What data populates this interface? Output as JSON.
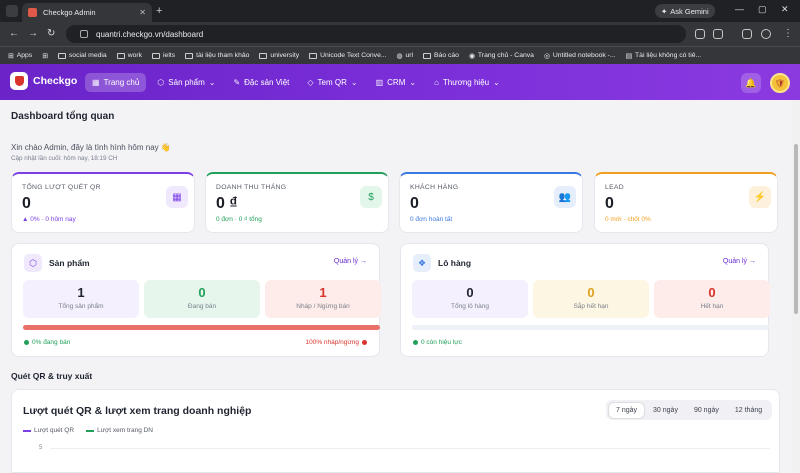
{
  "browser": {
    "tab_title": "Checkgo Admin",
    "gemini_label": "Ask Gemini",
    "url": "quantri.checkgo.vn/dashboard",
    "bookmarks": [
      "Apps",
      "social media",
      "work",
      "ielts",
      "tài liệu tham khảo",
      "university",
      "Unicode Text Conve...",
      "url",
      "Báo cáo",
      "Trang chủ - Canva",
      "Untitled notebook -...",
      "Tài liệu không có tiê..."
    ]
  },
  "nav": {
    "brand": "Checkgo",
    "items": [
      {
        "label": "Trang chủ",
        "icon": "grid-icon",
        "glyph": "▦"
      },
      {
        "label": "Sản phẩm",
        "icon": "box-icon",
        "glyph": "⬡",
        "caret": "⌄"
      },
      {
        "label": "Đặc sản Việt",
        "icon": "pen-icon",
        "glyph": "✎"
      },
      {
        "label": "Tem QR",
        "icon": "tag-icon",
        "glyph": "◇",
        "caret": "⌄"
      },
      {
        "label": "CRM",
        "icon": "chart-icon",
        "glyph": "▥",
        "caret": "⌄"
      },
      {
        "label": "Thương hiệu",
        "icon": "store-icon",
        "glyph": "⌂",
        "caret": "⌄"
      }
    ]
  },
  "page": {
    "title": "Dashboard tổng quan",
    "greeting": "Xin chào Admin, đây là tình hình hôm nay 👋",
    "updated": "Cập nhật lần cuối: hôm nay, 18:19 CH"
  },
  "stats": [
    {
      "label": "TỔNG LƯỢT QUÉT QR",
      "value": "0",
      "sub": "▲ 0% · 0 hôm nay",
      "color": "#7b3fe4",
      "tint": "#f0e9fd",
      "glyph": "▦"
    },
    {
      "label": "DOANH THU THÁNG",
      "value": "0 ₫",
      "sub": "0 đơn · 0 ₫ tổng",
      "color": "#22a05a",
      "tint": "#e3f6ea",
      "glyph": "$"
    },
    {
      "label": "KHÁCH HÀNG",
      "value": "0",
      "sub": "0 đơn hoàn tất",
      "color": "#3a78e0",
      "tint": "#e6eefc",
      "glyph": "👥"
    },
    {
      "label": "LEAD",
      "value": "0",
      "sub": "0 mới · chốt 0%",
      "color": "#f0a020",
      "tint": "#fdf1dc",
      "glyph": "⚡"
    }
  ],
  "products": {
    "title": "Sản phẩm",
    "link": "Quản lý →",
    "boxes": [
      {
        "value": "1",
        "label": "Tổng sản phẩm",
        "bg": "#f5f0fd",
        "fg": "#1f2430"
      },
      {
        "value": "0",
        "label": "Đang bán",
        "bg": "#e6f6ec",
        "fg": "#22a05a"
      },
      {
        "value": "1",
        "label": "Nháp / Ngừng bán",
        "bg": "#fdecea",
        "fg": "#d9342b"
      }
    ],
    "active_fraction": 0,
    "foot_left": "0% đang bán",
    "foot_right": "100% nháp/ngừng"
  },
  "batches": {
    "title": "Lô hàng",
    "link": "Quản lý →",
    "boxes": [
      {
        "value": "0",
        "label": "Tổng lô hàng",
        "bg": "#f5f0fd",
        "fg": "#1f2430"
      },
      {
        "value": "0",
        "label": "Sắp hết hạn",
        "bg": "#fdf6e3",
        "fg": "#e0a020"
      },
      {
        "value": "0",
        "label": "Hết hạn",
        "bg": "#fdecea",
        "fg": "#d9342b"
      }
    ],
    "foot_left": "0 còn hiệu lực"
  },
  "section_title": "Quét QR & truy xuất",
  "chart": {
    "title": "Lượt quét QR & lượt xem trang doanh nghiệp",
    "ranges": [
      "7 ngày",
      "30 ngày",
      "90 ngày",
      "12 tháng"
    ],
    "active_range": 0,
    "legend": [
      {
        "name": "Lượt quét QR",
        "color": "#7b3fe4"
      },
      {
        "name": "Lượt xem trang DN",
        "color": "#22a05a"
      }
    ],
    "ytick": "5"
  }
}
